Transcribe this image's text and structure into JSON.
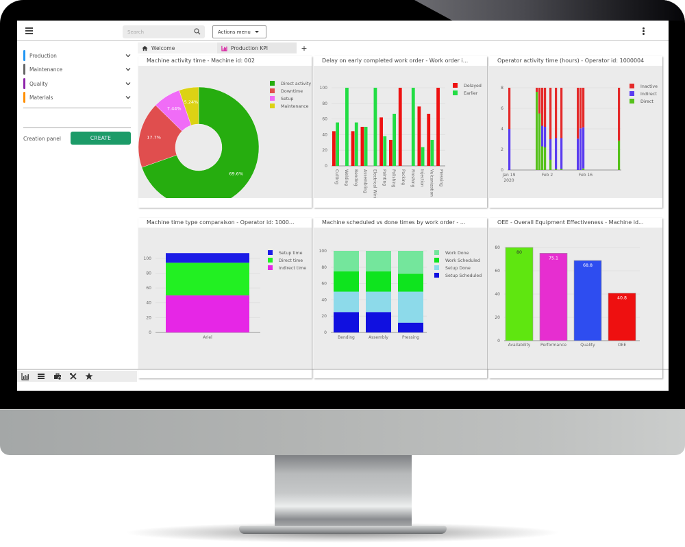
{
  "app": {
    "search_placeholder": "Search",
    "actions_menu_label": "Actions menu",
    "menu_icon": "hamburger-icon",
    "more_icon": "kebab-icon"
  },
  "sidebar": {
    "categories": [
      {
        "label": "Production",
        "color": "#2196f3"
      },
      {
        "label": "Maintenance",
        "color": "#666666"
      },
      {
        "label": "Quality",
        "color": "#8e24aa"
      },
      {
        "label": "Materials",
        "color": "#ff8f00"
      }
    ],
    "creation_panel_label": "Creation panel",
    "create_button_label": "CREATE",
    "create_button_color": "#1c9b68",
    "bottom_tools": [
      "chart-icon",
      "list-icon",
      "toolbox-icon",
      "tools-icon",
      "star-icon"
    ]
  },
  "tabs": [
    {
      "label": "Welcome",
      "icon": "home-icon"
    },
    {
      "label": "Production KPI",
      "icon": "chart-icon",
      "active": true
    },
    {
      "label": "+",
      "icon": "add-tab-icon"
    }
  ],
  "chart_data": [
    {
      "type": "pie",
      "title": "Machine activity time - Machine id: 002",
      "donut": true,
      "legend": "top-right",
      "slices": [
        {
          "label": "Direct activity",
          "value": 69.6,
          "text": "69.6%",
          "color": "#26ad0f"
        },
        {
          "label": "Downtime",
          "value": 17.7,
          "text": "17.7%",
          "color": "#e04e4e"
        },
        {
          "label": "Setup",
          "value": 7.44,
          "text": "7.44%",
          "color": "#f06cf7"
        },
        {
          "label": "Maintenance",
          "value": 5.24,
          "text": "5.24%",
          "color": "#dcd214"
        }
      ]
    },
    {
      "type": "bar",
      "title": "Delay on early completed work order - Work order i...",
      "legend": "top-right",
      "ylim": [
        0,
        100
      ],
      "yticks": [
        0,
        20,
        40,
        60,
        80,
        100
      ],
      "categories": [
        "Cutting",
        "Welding",
        "Bending",
        "Assembling",
        "Electrical Wiring",
        "Painting",
        "Polishing",
        "Packing",
        "Finishing",
        "Injection",
        "Vulcanization",
        "Pressing"
      ],
      "series": [
        {
          "name": "Delayed",
          "color": "#ee1111",
          "values": [
            44.4,
            0,
            44.4,
            50,
            0,
            62,
            33.3,
            100,
            0,
            76,
            66.7,
            100
          ]
        },
        {
          "name": "Earlier",
          "color": "#22dd44",
          "values": [
            55.6,
            100,
            55.6,
            50,
            100,
            38,
            66.7,
            0,
            100,
            24,
            33.3,
            0
          ]
        }
      ]
    },
    {
      "type": "bar",
      "stacked": true,
      "title": "Operator activity time (hours) - Operator id: 1000004",
      "legend": "top-right",
      "ylim": [
        0,
        8
      ],
      "yticks": [
        0,
        2,
        4,
        6,
        8
      ],
      "x_range_days": [
        "2020-01-19",
        "2020-02-27"
      ],
      "xtick_labels": [
        {
          "label": "Jan 19",
          "sublabel": "2020",
          "day": 0
        },
        {
          "label": "Feb 2",
          "sublabel": "",
          "day": 14
        },
        {
          "label": "Feb 16",
          "sublabel": "",
          "day": 28
        }
      ],
      "bars": [
        {
          "day": 0,
          "Direct": 0,
          "Indirect": 4.0,
          "Inactive": 4.0
        },
        {
          "day": 10,
          "Direct": 7.6,
          "Indirect": 0,
          "Inactive": 0.4
        },
        {
          "day": 11,
          "Direct": 5.5,
          "Indirect": 0,
          "Inactive": 2.5
        },
        {
          "day": 12,
          "Direct": 2.3,
          "Indirect": 2.0,
          "Inactive": 3.7
        },
        {
          "day": 13,
          "Direct": 2.2,
          "Indirect": 2.0,
          "Inactive": 3.8
        },
        {
          "day": 15,
          "Direct": 1.0,
          "Indirect": 2.0,
          "Inactive": 5.0
        },
        {
          "day": 17,
          "Direct": 0.1,
          "Indirect": 3.0,
          "Inactive": 4.9
        },
        {
          "day": 19,
          "Direct": 0.1,
          "Indirect": 3.0,
          "Inactive": 4.9
        },
        {
          "day": 25,
          "Direct": 0,
          "Indirect": 3.05,
          "Inactive": 4.95
        },
        {
          "day": 26,
          "Direct": 0,
          "Indirect": 4.05,
          "Inactive": 3.95
        },
        {
          "day": 27,
          "Direct": 0.15,
          "Indirect": 4.0,
          "Inactive": 3.85
        },
        {
          "day": 40,
          "Direct": 2.85,
          "Indirect": 0,
          "Inactive": 5.15
        }
      ],
      "series": [
        {
          "name": "Inactive",
          "color": "#e42a2a"
        },
        {
          "name": "Indirect",
          "color": "#5a3cf0"
        },
        {
          "name": "Direct",
          "color": "#55c11a"
        }
      ],
      "x_max_day": 40
    },
    {
      "type": "bar",
      "stacked": true,
      "title": "Machine time type comparaison - Operator id: 1000...",
      "legend": "top-right",
      "ylim": [
        0,
        110
      ],
      "yticks": [
        0,
        20,
        40,
        60,
        80,
        100
      ],
      "categories": [
        "Ariel"
      ],
      "series": [
        {
          "name": "Indirect time",
          "color": "#e626e6",
          "values": [
            50
          ]
        },
        {
          "name": "Direct time",
          "color": "#22f022",
          "values": [
            44
          ]
        },
        {
          "name": "Setup time",
          "color": "#1c1ce6",
          "values": [
            13
          ]
        }
      ],
      "legend_order": [
        "Setup time",
        "Direct time",
        "Indirect time"
      ]
    },
    {
      "type": "bar",
      "stacked": true,
      "title": "Machine scheduled vs done times by work order - ...",
      "legend": "top-right",
      "ylim": [
        0,
        100
      ],
      "yticks": [
        0,
        20,
        40,
        60,
        80,
        100
      ],
      "categories": [
        "Bending",
        "Assembly",
        "Pressing"
      ],
      "series": [
        {
          "name": "Setup Scheduled",
          "color": "#1010e0",
          "values": [
            25,
            25,
            12
          ]
        },
        {
          "name": "Setup Done",
          "color": "#8ddaea",
          "values": [
            25,
            25,
            38
          ]
        },
        {
          "name": "Work Scheduled",
          "color": "#0ee41e",
          "values": [
            25,
            25,
            22
          ]
        },
        {
          "name": "Work Done",
          "color": "#74e69c",
          "values": [
            25,
            25,
            28
          ]
        }
      ],
      "legend_order": [
        "Work Done",
        "Work Scheduled",
        "Setup Done",
        "Setup Scheduled"
      ]
    },
    {
      "type": "bar",
      "title": "OEE - Overall Equipment Effectiveness - Machine id...",
      "ylim": [
        0,
        80
      ],
      "yticks": [
        0,
        20,
        40,
        60,
        80
      ],
      "categories": [
        "Availability",
        "Performance",
        "Quality",
        "OEE"
      ],
      "values": [
        80,
        75.1,
        68.8,
        40.8
      ],
      "labels": [
        "80",
        "75.1",
        "68.8",
        "40.8"
      ],
      "colors": [
        "#5fe610",
        "#e62ed0",
        "#2e4df0",
        "#ee1010"
      ],
      "label_colors": [
        "#333333",
        "#ffffff",
        "#ffffff",
        "#ffffff"
      ]
    }
  ]
}
